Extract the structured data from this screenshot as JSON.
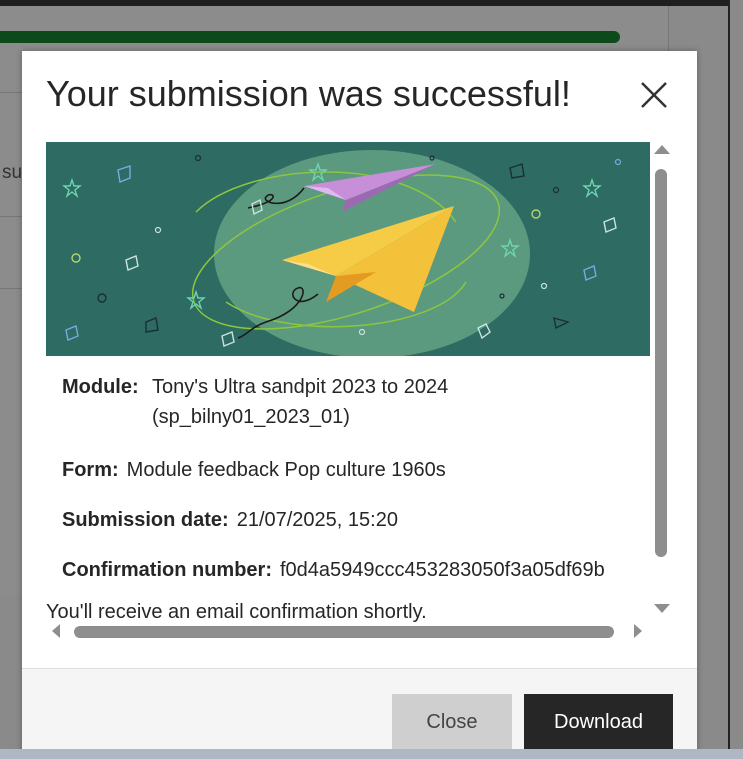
{
  "background": {
    "partial_text": "su"
  },
  "dialog": {
    "title": "Your submission was successful!",
    "close_icon": "close-icon",
    "details": {
      "module_label": "Module:",
      "module_value_line1": "Tony's Ultra sandpit 2023 to 2024",
      "module_value_line2": "(sp_bilny01_2023_01)",
      "form_label": "Form:",
      "form_value": "Module feedback Pop culture 1960s",
      "date_label": "Submission date:",
      "date_value": "21/07/2025, 15:20",
      "confirmation_label": "Confirmation number:",
      "confirmation_value": "f0d4a5949ccc453283050f3a05df69b"
    },
    "email_note": "You'll receive an email confirmation shortly.",
    "buttons": {
      "close_label": "Close",
      "download_label": "Download"
    }
  },
  "colors": {
    "banner_bg": "#2d6b63",
    "progress": "#0c4a1c",
    "download_bg": "#262626",
    "close_bg": "#cfcfcf"
  }
}
